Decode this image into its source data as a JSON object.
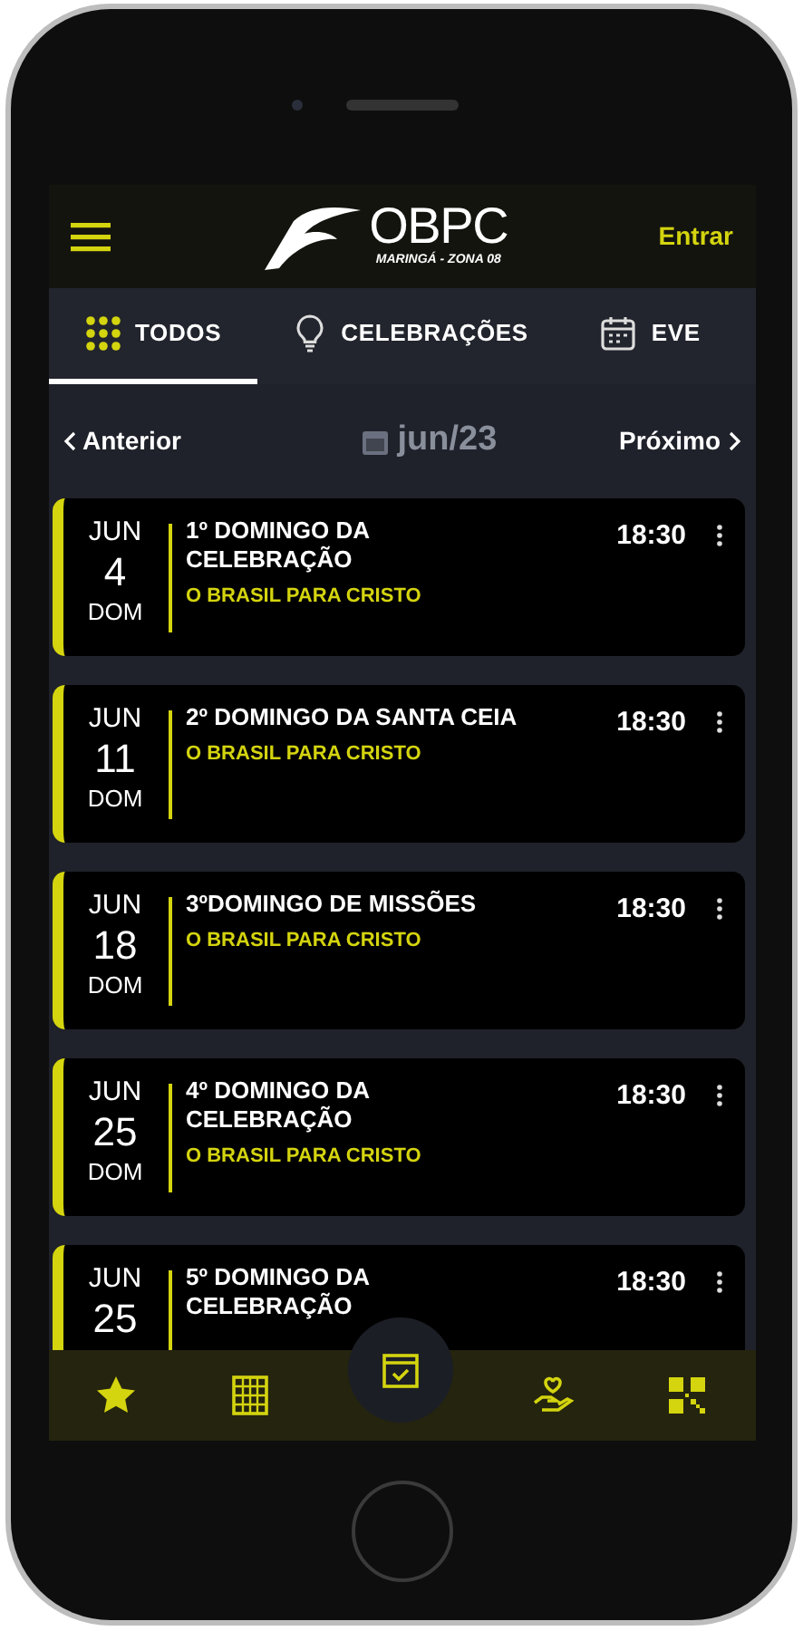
{
  "header": {
    "brand": "OBPC",
    "subtitle": "MARINGÁ - ZONA 08",
    "login": "Entrar"
  },
  "tabs": [
    {
      "label": "TODOS",
      "kind": "grid",
      "selected": true
    },
    {
      "label": "CELEBRAÇÕES",
      "kind": "bulb",
      "selected": false
    },
    {
      "label": "EVE",
      "kind": "calendar",
      "selected": false
    }
  ],
  "month_nav": {
    "previous": "Anterior",
    "month": "jun/23",
    "next": "Próximo"
  },
  "events": [
    {
      "month": "JUN",
      "day": "4",
      "weekday": "DOM",
      "title": "1º DOMINGO DA CELEBRAÇÃO",
      "organizer": "O BRASIL PARA CRISTO",
      "time": "18:30"
    },
    {
      "month": "JUN",
      "day": "11",
      "weekday": "DOM",
      "title": "2º DOMINGO DA SANTA CEIA",
      "organizer": "O BRASIL PARA CRISTO",
      "time": "18:30"
    },
    {
      "month": "JUN",
      "day": "18",
      "weekday": "DOM",
      "title": "3ºDOMINGO DE MISSÕES",
      "organizer": "O BRASIL PARA CRISTO",
      "time": "18:30"
    },
    {
      "month": "JUN",
      "day": "25",
      "weekday": "DOM",
      "title": "4º DOMINGO DA CELEBRAÇÃO",
      "organizer": "O BRASIL PARA CRISTO",
      "time": "18:30"
    },
    {
      "month": "JUN",
      "day": "25",
      "title": "5º DOMINGO DA CELEBRAÇÃO",
      "time": "18:30"
    }
  ],
  "bottom_nav": [
    {
      "kind": "star",
      "selected": false
    },
    {
      "kind": "book",
      "selected": false
    },
    {
      "kind": "calendar",
      "selected": true
    },
    {
      "kind": "hand",
      "selected": false
    },
    {
      "kind": "qr",
      "selected": false
    }
  ]
}
